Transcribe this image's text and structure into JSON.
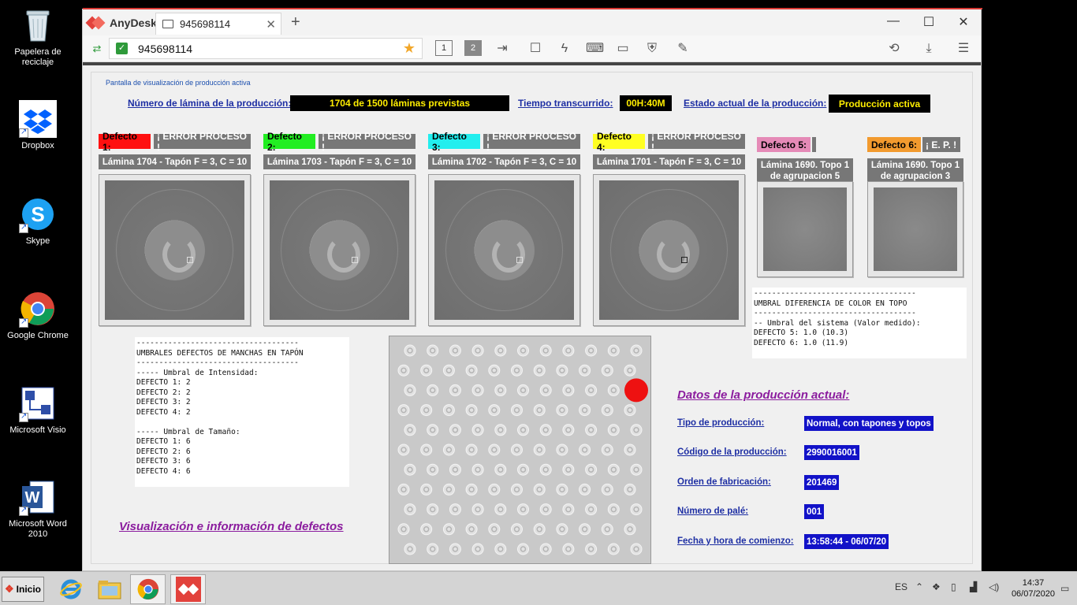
{
  "desktop": {
    "icons": [
      {
        "label": "Papelera de reciclaje"
      },
      {
        "label": "Dropbox"
      },
      {
        "label": "Skype"
      },
      {
        "label": "Google Chrome"
      },
      {
        "label": "Microsoft Visio"
      },
      {
        "label": "Microsoft Word 2010"
      }
    ]
  },
  "anydesk": {
    "app_name": "AnyDesk",
    "tab_label": "945698114",
    "address_value": "945698114",
    "monitor_buttons": [
      "1",
      "2"
    ]
  },
  "screen": {
    "breadcrumb": "Pantalla de visualización de producción activa",
    "header": {
      "sheet_label": "Número de lámina de la producción:",
      "sheet_value": "1704 de 1500 láminas previstas",
      "time_label": "Tiempo transcurrido:",
      "time_value": "00H:40M",
      "state_label": "Estado actual de la producción:",
      "state_value": "Producción activa"
    },
    "defects": [
      {
        "label": "Defecto 1:",
        "status": "¡ ERROR PROCESO !",
        "caption": "Lámina 1704 - Tapón F = 3, C = 10",
        "color": "#ff1010"
      },
      {
        "label": "Defecto 2:",
        "status": "¡ ERROR PROCESO !",
        "caption": "Lámina 1703 - Tapón F = 3, C = 10",
        "color": "#22ee22"
      },
      {
        "label": "Defecto 3:",
        "status": "¡ ERROR PROCESO !",
        "caption": "Lámina 1702 - Tapón F = 3, C = 10",
        "color": "#22eeee"
      },
      {
        "label": "Defecto 4:",
        "status": "¡ ERROR PROCESO !",
        "caption": "Lámina 1701 - Tapón F = 3, C = 10",
        "color": "#ffff22"
      },
      {
        "label": "Defecto 5:",
        "status": "",
        "caption": "Lámina 1690. Topo 1 de agrupacion 5",
        "color": "#e58ab7"
      },
      {
        "label": "Defecto 6:",
        "status": "¡ E. P. !",
        "caption": "Lámina 1690. Topo 1 de agrupacion 3",
        "color": "#f29a2e"
      }
    ],
    "color_threshold_text": "------------------------------------\nUMBRAL DIFERENCIA DE COLOR EN TOPO\n------------------------------------\n-- Umbral del sistema (Valor medido):\nDEFECTO 5: 1.0 (10.3)\nDEFECTO 6: 1.0 (11.9)",
    "stain_threshold_text": "------------------------------------\nUMBRALES DEFECTOS DE MANCHAS EN TAPÓN\n------------------------------------\n----- Umbral de Intensidad:\nDEFECTO 1: 2\nDEFECTO 2: 2\nDEFECTO 3: 2\nDEFECTO 4: 2\n\n----- Umbral de Tamaño:\nDEFECTO 1: 6\nDEFECTO 2: 6\nDEFECTO 3: 6\nDEFECTO 4: 6",
    "defects_title": "Visualización e información de defectos",
    "production": {
      "title": "Datos de la producción actual:",
      "fields": [
        {
          "label": "Tipo de producción:",
          "value": "Normal, con tapones y topos"
        },
        {
          "label": "Código de la producción:",
          "value": "2990016001"
        },
        {
          "label": "Orden de fabricación:",
          "value": "201469"
        },
        {
          "label": "Número de palé:",
          "value": "001"
        },
        {
          "label": "Fecha y hora de comienzo:",
          "value": "13:58:44 - 06/07/20"
        }
      ]
    },
    "plate": {
      "rows": 11,
      "cols": 11,
      "highlight": {
        "row": 3,
        "col": 11,
        "color": "#ee1111"
      }
    }
  },
  "taskbar": {
    "start_label": "Inicio",
    "language": "ES",
    "time": "14:37",
    "date": "06/07/2020"
  }
}
